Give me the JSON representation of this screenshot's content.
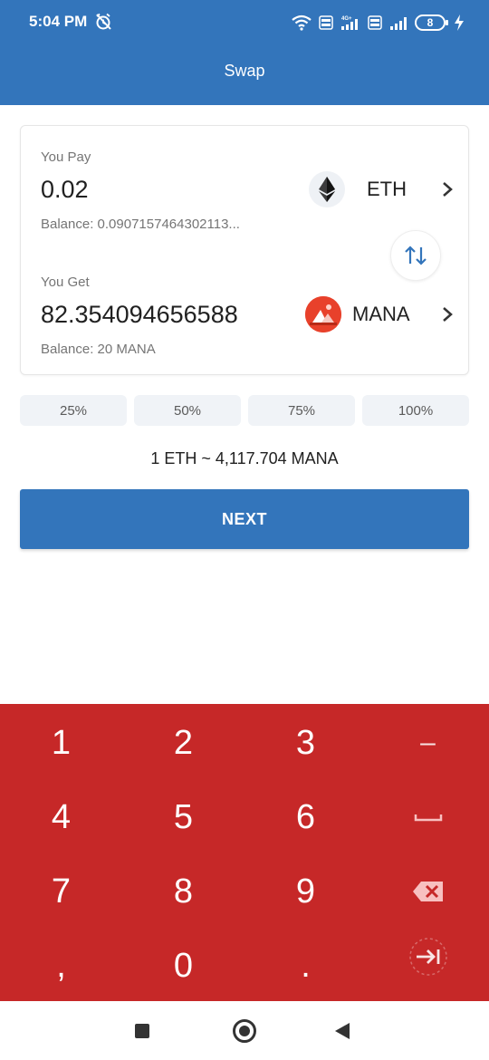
{
  "status_bar": {
    "time": "5:04 PM",
    "battery_level": "8",
    "icons": [
      "alarm-off-icon",
      "wifi-icon",
      "volte-icon",
      "signal-icon",
      "volte-icon",
      "signal-icon",
      "battery-icon",
      "charging-icon"
    ]
  },
  "header": {
    "title": "Swap"
  },
  "swap": {
    "pay": {
      "label": "You Pay",
      "amount": "0.02",
      "token": "ETH",
      "token_icon": "ethereum-icon",
      "balance": "Balance: 0.0907157464302113..."
    },
    "get": {
      "label": "You Get",
      "amount": "82.354094656588",
      "token": "MANA",
      "token_icon": "decentraland-icon",
      "balance": "Balance: 20 MANA"
    },
    "switch_icon": "swap-arrows-icon"
  },
  "percent_buttons": [
    "25%",
    "50%",
    "75%",
    "100%"
  ],
  "rate": "1 ETH ~ 4,117.704 MANA",
  "next_label": "NEXT",
  "keypad": {
    "keys": [
      "1",
      "2",
      "3",
      "–",
      "4",
      "5",
      "6",
      "␣",
      "7",
      "8",
      "9",
      "⌫",
      ",",
      "0",
      ".",
      "⇥"
    ]
  },
  "colors": {
    "primary": "#3375BB",
    "keypad": "#C62828",
    "text": "#212121",
    "muted": "#757575",
    "pct_bg": "#f0f3f7",
    "mana_red": "#E8412B"
  }
}
